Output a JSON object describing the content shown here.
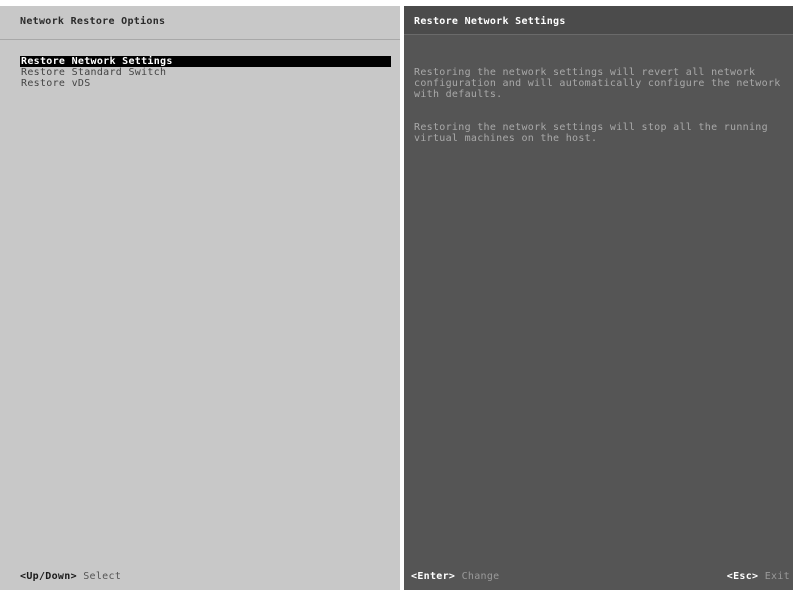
{
  "left_panel": {
    "title": "Network Restore Options",
    "menu_items": [
      {
        "label": "Restore Network Settings",
        "selected": true
      },
      {
        "label": "Restore Standard Switch",
        "selected": false
      },
      {
        "label": "Restore vDS",
        "selected": false
      }
    ],
    "footer": {
      "key": "<Up/Down>",
      "action": "Select"
    }
  },
  "right_panel": {
    "title": "Restore Network Settings",
    "description": [
      "Restoring the network settings will revert all network configuration and will automatically configure the network with defaults.",
      "Restoring the network settings will stop all the running virtual machines on the host."
    ],
    "footer_left": {
      "key": "<Enter>",
      "action": "Change"
    },
    "footer_right": {
      "key": "<Esc>",
      "action": "Exit"
    }
  },
  "colors": {
    "left_background": "#c8c8c8",
    "right_background": "#555555",
    "selection_background": "#000000",
    "selection_text": "#ffffff"
  }
}
